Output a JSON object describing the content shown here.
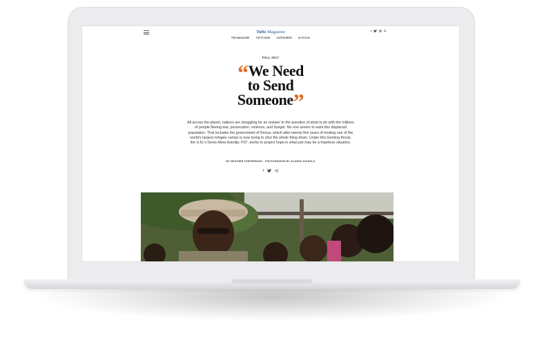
{
  "site": {
    "brand_bold": "Tufts",
    "brand_rest": " Magazine",
    "nav": [
      "THE MAGAZINE",
      "TUFTS NOW",
      "CATEGORIES",
      "IN FOCUS"
    ],
    "social_icons": [
      "facebook-icon",
      "twitter-icon",
      "instagram-icon",
      "search-icon"
    ]
  },
  "article": {
    "issue": "FALL 2017",
    "headline_line1": "We Need",
    "headline_line2": "to Send",
    "headline_line3": "Someone",
    "open_quote": "“",
    "close_quote": "”",
    "dek": "All across the planet, nations are struggling for an answer to the question of what to do with the millions of people fleeing war, persecution, violence, and hunger. No one seems to want this displaced population. That includes the government of Kenya, which after twenty-five years of hosting one of the world’s largest refugee camps is now trying to shut the whole thing down. Under this looming threat, the U.N.’s Denis Alma Kuindje, F07, works to project hope in what just may be a hopeless situation.",
    "byline_author": "BY HEATHER STEPHENSON",
    "byline_photos": "PHOTOGRAPHS BY ALONSO NICHOLS",
    "share_icons": [
      "facebook-icon",
      "twitter-icon",
      "share-icon"
    ]
  },
  "colors": {
    "accent_quote": "#e36b1e",
    "brand_blue": "#2b5a9a"
  }
}
